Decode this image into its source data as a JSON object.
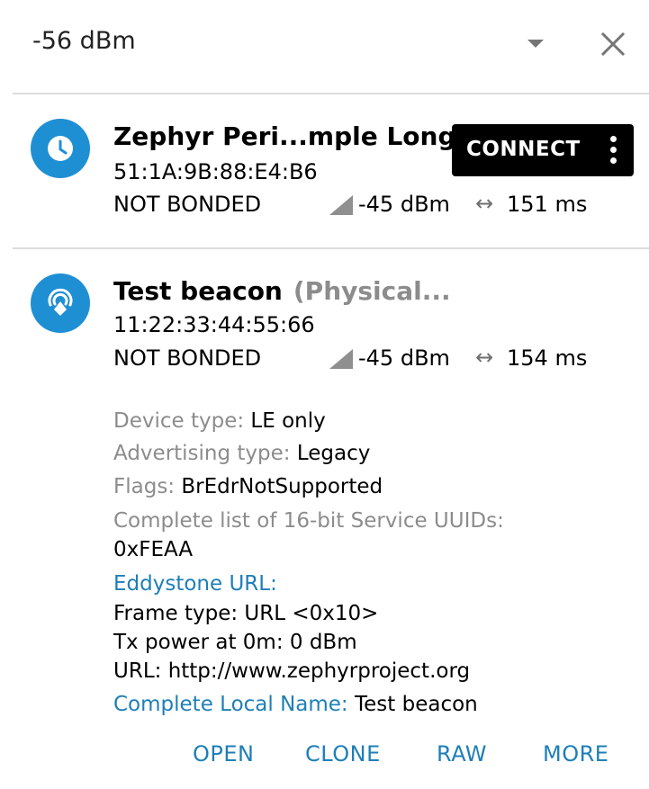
{
  "filter": {
    "rssi_value": "-56 dBm"
  },
  "devices": [
    {
      "name": "Zephyr Peri...mple Long",
      "address": "51:1A:9B:88:E4:B6",
      "bond_state": "NOT BONDED",
      "rssi": "-45 dBm",
      "interval": "151 ms",
      "connect_label": "CONNECT",
      "icon": "clock-icon"
    },
    {
      "name": "Test beacon",
      "name_extra": "(Physical...",
      "address": "11:22:33:44:55:66",
      "bond_state": "NOT BONDED",
      "rssi": "-45 dBm",
      "interval": "154 ms",
      "icon": "beacon-icon",
      "details": {
        "device_type_label": "Device type:",
        "device_type_value": "LE only",
        "adv_type_label": "Advertising type:",
        "adv_type_value": "Legacy",
        "flags_label": "Flags:",
        "flags_value": "BrEdrNotSupported",
        "uuids_label": "Complete list of 16-bit Service UUIDs:",
        "uuids_value": "0xFEAA",
        "eddystone_label": "Eddystone URL:",
        "frame_type": "Frame type: URL <0x10>",
        "tx_power": "Tx power at 0m: 0 dBm",
        "url": "URL: http://www.zephyrproject.org",
        "local_name_label": "Complete Local Name:",
        "local_name_value": "Test beacon"
      },
      "actions": {
        "open": "OPEN",
        "clone": "CLONE",
        "raw": "RAW",
        "more": "MORE"
      }
    }
  ],
  "colors": {
    "accent": "#1e7fb8",
    "avatar": "#1f8fd4",
    "label_gray": "#8c8c8c",
    "button_bg": "#000000"
  }
}
